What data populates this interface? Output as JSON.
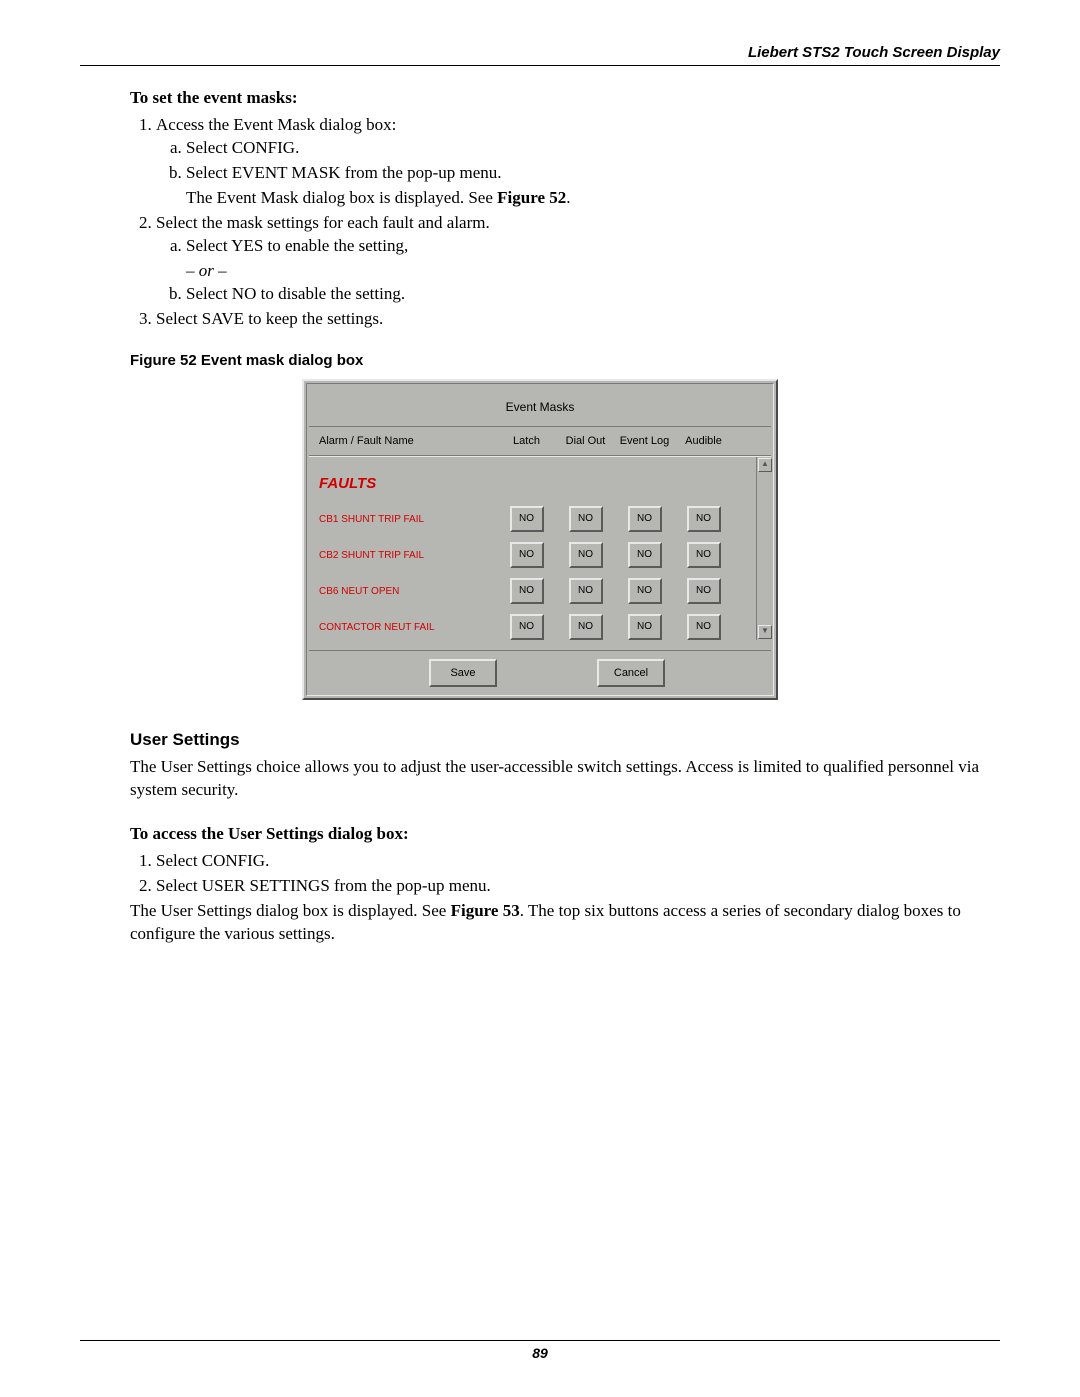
{
  "header": {
    "title": "Liebert STS2 Touch Screen Display"
  },
  "footer": {
    "page_number": "89"
  },
  "section1": {
    "heading": "To set the event masks:",
    "step1": "Access the Event Mask dialog box:",
    "step1a": "Select CONFIG.",
    "step1b": "Select EVENT MASK from the pop-up menu.",
    "step1_after": "The Event Mask dialog box is displayed. See ",
    "step1_fig": "Figure 52",
    "step1_after2": ".",
    "step2": "Select the mask settings for each fault and alarm.",
    "step2a": "Select YES to enable the setting,",
    "step2_or": "– or –",
    "step2b": "Select NO to disable the setting.",
    "step3": "Select SAVE to keep the settings."
  },
  "figure": {
    "caption": "Figure 52  Event mask dialog box",
    "title": "Event Masks",
    "col_name": "Alarm / Fault Name",
    "cols": [
      "Latch",
      "Dial Out",
      "Event Log",
      "Audible"
    ],
    "faults_label": "FAULTS",
    "rows": [
      {
        "name": "CB1 SHUNT TRIP FAIL",
        "vals": [
          "NO",
          "NO",
          "NO",
          "NO"
        ]
      },
      {
        "name": "CB2 SHUNT TRIP FAIL",
        "vals": [
          "NO",
          "NO",
          "NO",
          "NO"
        ]
      },
      {
        "name": "CB6 NEUT OPEN",
        "vals": [
          "NO",
          "NO",
          "NO",
          "NO"
        ]
      },
      {
        "name": "CONTACTOR NEUT FAIL",
        "vals": [
          "NO",
          "NO",
          "NO",
          "NO"
        ]
      }
    ],
    "save": "Save",
    "cancel": "Cancel"
  },
  "section2": {
    "heading": "User Settings",
    "para1": "The User Settings choice allows you to adjust the user-accessible switch settings. Access is limited to qualified personnel via system security.",
    "subheading": "To access the User Settings dialog box:",
    "step1": "Select CONFIG.",
    "step2": "Select USER SETTINGS from the pop-up menu.",
    "para2a": "The User Settings dialog box is displayed. See ",
    "para2_fig": "Figure 53",
    "para2b": ". The top six buttons access a series of secondary dialog boxes to configure the various settings."
  }
}
